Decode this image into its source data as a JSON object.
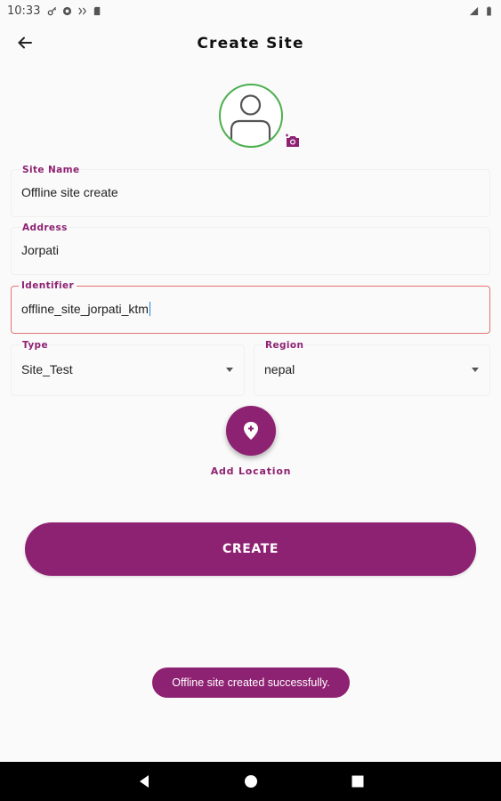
{
  "status_bar": {
    "time": "10:33",
    "icons_left": [
      "key-icon",
      "sync-icon",
      "network-icon",
      "sd-card-icon"
    ],
    "icons_right": [
      "wifi-icon",
      "battery-icon"
    ]
  },
  "app_bar": {
    "title": "Create Site",
    "back_icon": "arrow-left-icon"
  },
  "avatar": {
    "icon": "person-icon",
    "camera_icon": "camera-add-icon",
    "border_color": "#4caf50"
  },
  "form": {
    "site_name": {
      "label": "Site Name",
      "value": "Offline site create"
    },
    "address": {
      "label": "Address",
      "value": "Jorpati"
    },
    "identifier": {
      "label": "Identifier",
      "value": "offline_site_jorpati_ktm"
    },
    "type": {
      "label": "Type",
      "value": "Site_Test"
    },
    "region": {
      "label": "Region",
      "value": "nepal"
    }
  },
  "location": {
    "icon": "add-location-icon",
    "label": "Add Location"
  },
  "create_button": {
    "label": "CREATE"
  },
  "toast": {
    "message": "Offline site created successfully."
  },
  "nav_bar": {
    "icons": [
      "back-triangle-icon",
      "home-circle-icon",
      "recents-square-icon"
    ]
  },
  "colors": {
    "accent": "#8e2272",
    "focus_border": "#e57373",
    "avatar_ring": "#4caf50",
    "caret": "#1e88e5"
  }
}
